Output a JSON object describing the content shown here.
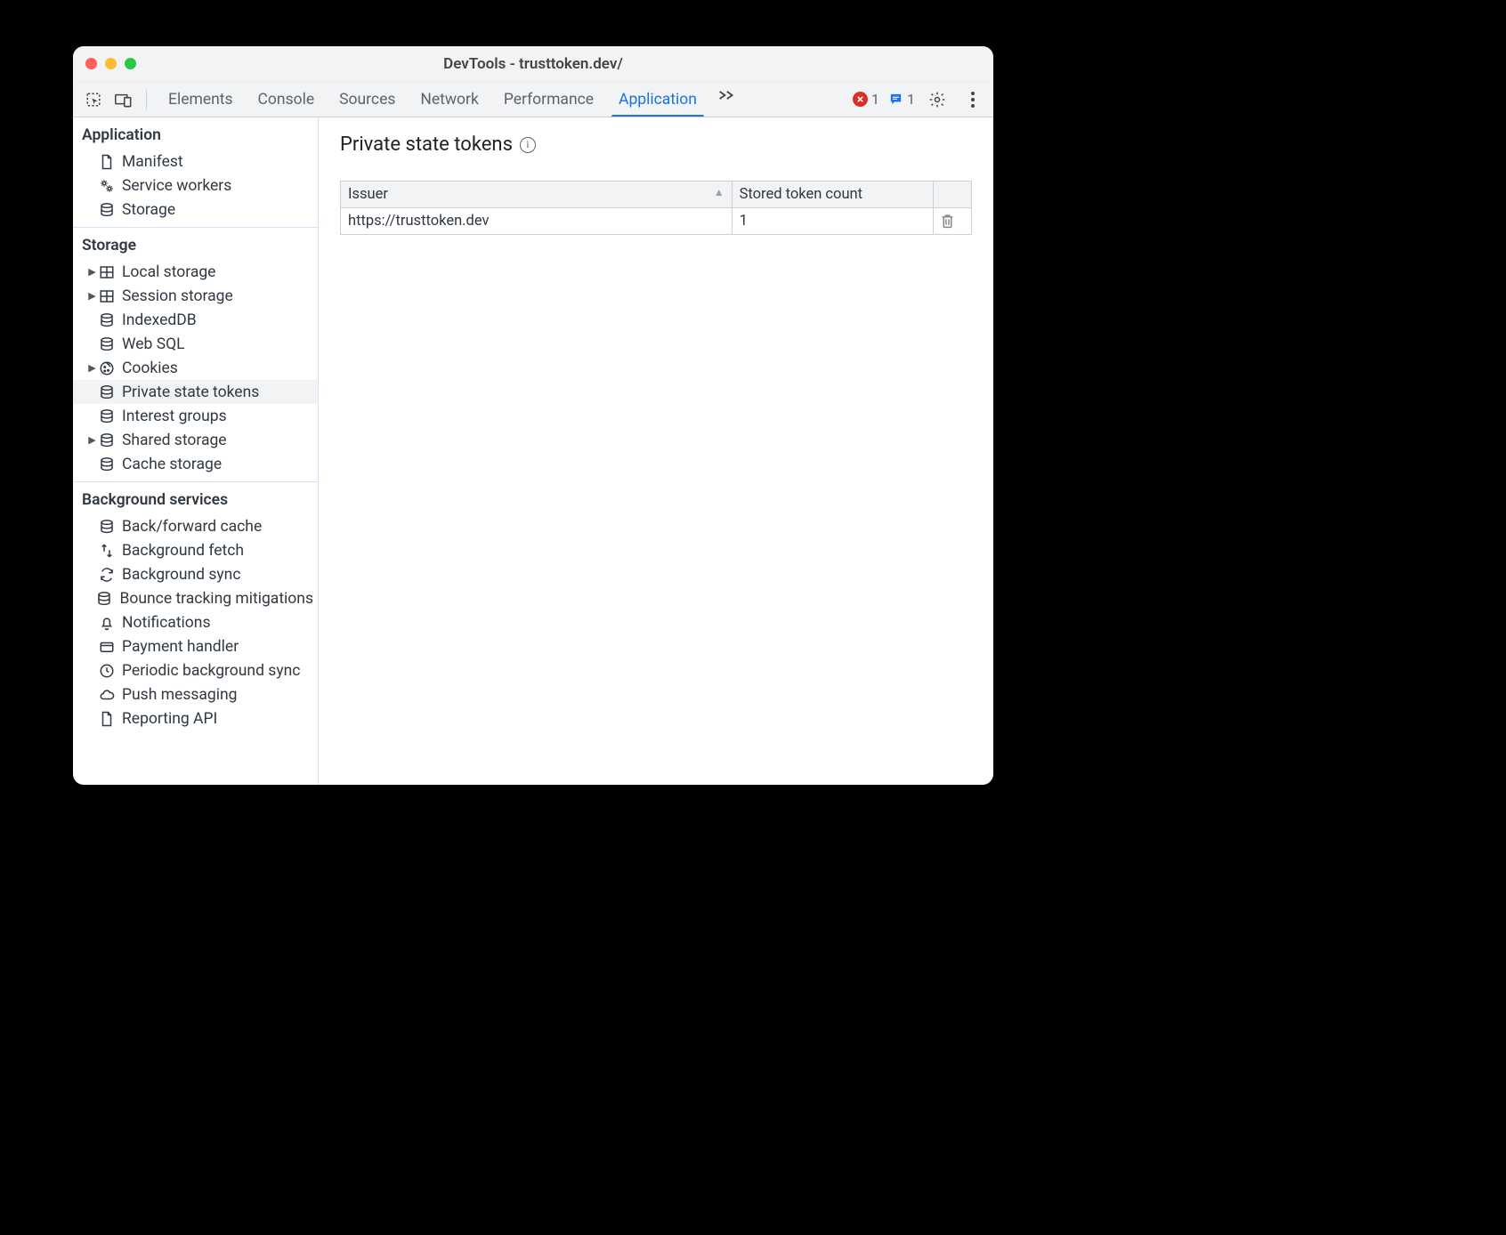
{
  "window": {
    "title": "DevTools - trusttoken.dev/"
  },
  "toolbar": {
    "tabs": [
      "Elements",
      "Console",
      "Sources",
      "Network",
      "Performance",
      "Application"
    ],
    "active": "Application",
    "error_count": "1",
    "messages_count": "1"
  },
  "sidebar": {
    "sections": [
      {
        "title": "Application",
        "items": [
          {
            "label": "Manifest",
            "icon": "page",
            "caret": false
          },
          {
            "label": "Service workers",
            "icon": "gears",
            "caret": false
          },
          {
            "label": "Storage",
            "icon": "db",
            "caret": false
          }
        ]
      },
      {
        "title": "Storage",
        "items": [
          {
            "label": "Local storage",
            "icon": "grid",
            "caret": true
          },
          {
            "label": "Session storage",
            "icon": "grid",
            "caret": true
          },
          {
            "label": "IndexedDB",
            "icon": "db",
            "caret": false
          },
          {
            "label": "Web SQL",
            "icon": "db",
            "caret": false
          },
          {
            "label": "Cookies",
            "icon": "cookie",
            "caret": true
          },
          {
            "label": "Private state tokens",
            "icon": "db",
            "caret": false,
            "selected": true
          },
          {
            "label": "Interest groups",
            "icon": "db",
            "caret": false
          },
          {
            "label": "Shared storage",
            "icon": "db",
            "caret": true
          },
          {
            "label": "Cache storage",
            "icon": "db",
            "caret": false
          }
        ]
      },
      {
        "title": "Background services",
        "items": [
          {
            "label": "Back/forward cache",
            "icon": "db",
            "caret": false
          },
          {
            "label": "Background fetch",
            "icon": "fetch",
            "caret": false
          },
          {
            "label": "Background sync",
            "icon": "sync",
            "caret": false
          },
          {
            "label": "Bounce tracking mitigations",
            "icon": "db",
            "caret": false
          },
          {
            "label": "Notifications",
            "icon": "bell",
            "caret": false
          },
          {
            "label": "Payment handler",
            "icon": "card",
            "caret": false
          },
          {
            "label": "Periodic background sync",
            "icon": "clock",
            "caret": false
          },
          {
            "label": "Push messaging",
            "icon": "cloud",
            "caret": false
          },
          {
            "label": "Reporting API",
            "icon": "page",
            "caret": false
          }
        ],
        "last": true
      }
    ]
  },
  "panel": {
    "heading": "Private state tokens",
    "columns": [
      "Issuer",
      "Stored token count"
    ],
    "rows": [
      {
        "issuer": "https://trusttoken.dev",
        "count": "1"
      }
    ]
  }
}
